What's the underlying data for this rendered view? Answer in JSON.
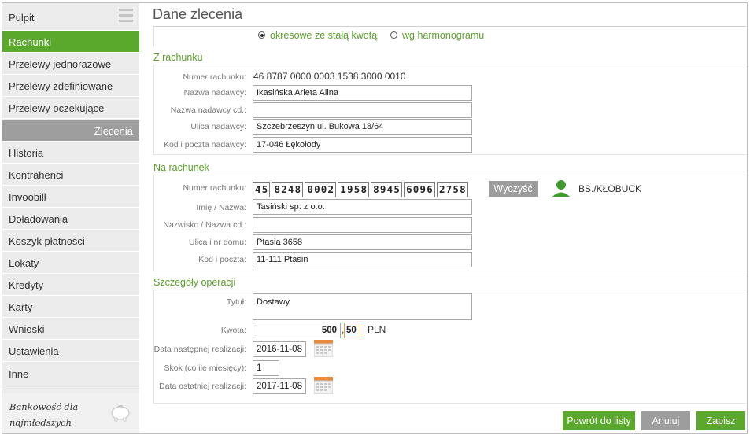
{
  "sidebar": {
    "items": [
      {
        "label": "Pulpit"
      },
      {
        "label": "Rachunki"
      },
      {
        "label": "Przelewy jednorazowe"
      },
      {
        "label": "Przelewy zdefiniowane"
      },
      {
        "label": "Przelewy oczekujące"
      },
      {
        "label": "Zlecenia"
      },
      {
        "label": "Historia"
      },
      {
        "label": "Kontrahenci"
      },
      {
        "label": "Invoobill"
      },
      {
        "label": "Doładowania"
      },
      {
        "label": "Koszyk płatności"
      },
      {
        "label": "Lokaty"
      },
      {
        "label": "Kredyty"
      },
      {
        "label": "Karty"
      },
      {
        "label": "Wnioski"
      },
      {
        "label": "Ustawienia"
      },
      {
        "label": "Inne"
      }
    ],
    "promo_line1": "Bankowość dla",
    "promo_line2": "najmłodszych"
  },
  "main": {
    "title": "Dane zlecenia",
    "mode_options": [
      "okresowe ze stałą kwotą",
      "wg harmonogramu"
    ],
    "mode_selected": "okresowe ze stałą kwotą"
  },
  "from_account": {
    "section_title": "Z rachunku",
    "account_number_label": "Numer rachunku:",
    "account_number": "46 8787 0000 0003 1538 3000 0010",
    "sender_name_label": "Nazwa nadawcy:",
    "sender_name": "Ikasińska Arleta Alina",
    "sender_name_cont_label": "Nazwa nadawcy cd.:",
    "sender_name_cont": "",
    "sender_street_label": "Ulica nadawcy:",
    "sender_street": "Szczebrzeszyn ul. Bukowa 18/64",
    "sender_postal_label": "Kod i poczta nadawcy:",
    "sender_postal": "17-046 Łękołody"
  },
  "to_account": {
    "section_title": "Na rachunek",
    "account_number_label": "Numer rachunku:",
    "account_segments": [
      "45",
      "8248",
      "0002",
      "1958",
      "8945",
      "6096",
      "2758"
    ],
    "clear_label": "Wyczyść",
    "bank_name": "BS./KŁOBUCK",
    "name_label": "Imię / Nazwa:",
    "name": "Tasiński sp. z o.o.",
    "name_cont_label": "Nazwisko / Nazwa cd.:",
    "name_cont": "",
    "street_label": "Ulica i nr domu:",
    "street": "Ptasia 3658",
    "postal_label": "Kod i poczta:",
    "postal": "11-111 Ptasin"
  },
  "details": {
    "section_title": "Szczegóły operacji",
    "title_label": "Tytuł:",
    "title": "Dostawy",
    "amount_label": "Kwota:",
    "amount_int": "500",
    "amount_dec": "50",
    "currency": "PLN",
    "next_date_label": "Data następnej realizacji:",
    "next_date": "2016-11-08",
    "step_label": "Skok (co ile miesięcy):",
    "step": "1",
    "last_date_label": "Data ostatniej realizacji:",
    "last_date": "2017-11-08"
  },
  "buttons": {
    "back": "Powrót do listy",
    "cancel": "Anuluj",
    "save": "Zapisz"
  },
  "colors": {
    "accent": "#5aa82c",
    "sidebar_bg": "#ececec",
    "section_bg": "#9e9e9e",
    "button_grey": "#9d9d9d"
  }
}
